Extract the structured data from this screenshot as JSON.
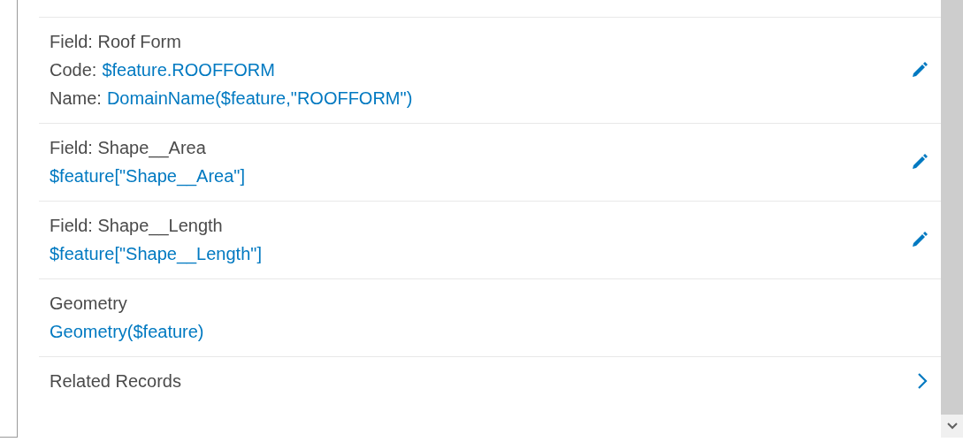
{
  "rows": [
    {
      "kind": "editable",
      "lines": [
        {
          "label": "Field: Roof Form"
        },
        {
          "label": "Code:",
          "expression": "$feature.ROOFFORM"
        },
        {
          "label": "Name:",
          "expression": "DomainName($feature,\"ROOFFORM\")"
        }
      ]
    },
    {
      "kind": "editable",
      "lines": [
        {
          "label": "Field: Shape__Area"
        },
        {
          "expression": "$feature[\"Shape__Area\"]"
        }
      ]
    },
    {
      "kind": "editable",
      "lines": [
        {
          "label": "Field: Shape__Length"
        },
        {
          "expression": "$feature[\"Shape__Length\"]"
        }
      ]
    },
    {
      "kind": "plain",
      "lines": [
        {
          "label": "Geometry"
        },
        {
          "expression": "Geometry($feature)"
        }
      ]
    },
    {
      "kind": "link",
      "lines": [
        {
          "label": "Related Records"
        }
      ]
    }
  ]
}
